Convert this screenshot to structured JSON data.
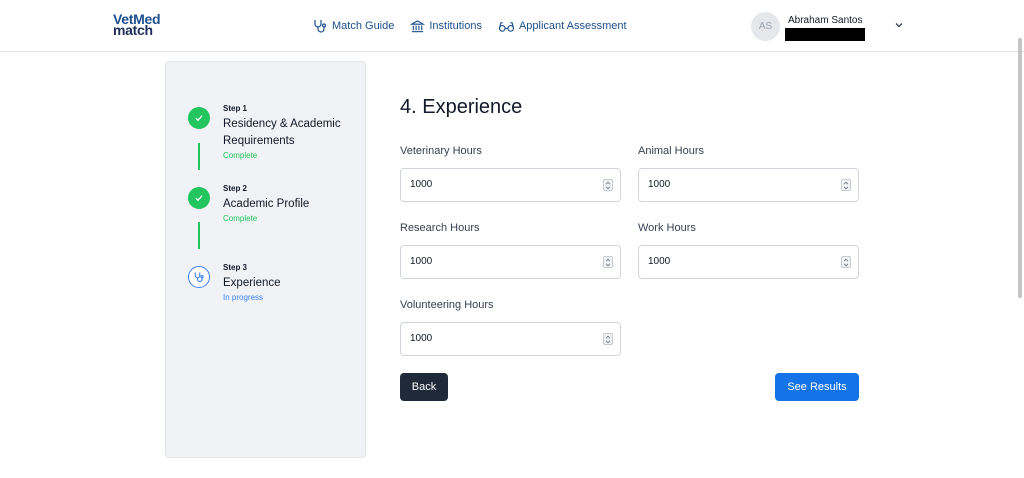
{
  "header": {
    "logo_line1_a": "Vet",
    "logo_line1_b": "Med",
    "logo_line2": "match",
    "nav": [
      {
        "label": "Match Guide",
        "icon": "stethoscope-icon"
      },
      {
        "label": "Institutions",
        "icon": "institution-icon"
      },
      {
        "label": "Applicant Assessment",
        "icon": "glasses-icon"
      }
    ],
    "user": {
      "initials": "AS",
      "name": "Abraham Santos"
    }
  },
  "sidebar": {
    "steps": [
      {
        "number": "Step 1",
        "title": "Residency & Academic Requirements",
        "status": "Complete"
      },
      {
        "number": "Step 2",
        "title": "Academic Profile",
        "status": "Complete"
      },
      {
        "number": "Step 3",
        "title": "Experience",
        "status": "In progress"
      }
    ]
  },
  "main": {
    "title": "4. Experience",
    "fields": {
      "veterinary": {
        "label": "Veterinary Hours",
        "value": "1000"
      },
      "animal": {
        "label": "Animal Hours",
        "value": "1000"
      },
      "research": {
        "label": "Research Hours",
        "value": "1000"
      },
      "work": {
        "label": "Work Hours",
        "value": "1000"
      },
      "volunteering": {
        "label": "Volunteering Hours",
        "value": "1000"
      }
    },
    "back_label": "Back",
    "results_label": "See Results"
  },
  "colors": {
    "accent": "#1473e6",
    "complete": "#22c55e",
    "dark_button": "#1f2937"
  }
}
